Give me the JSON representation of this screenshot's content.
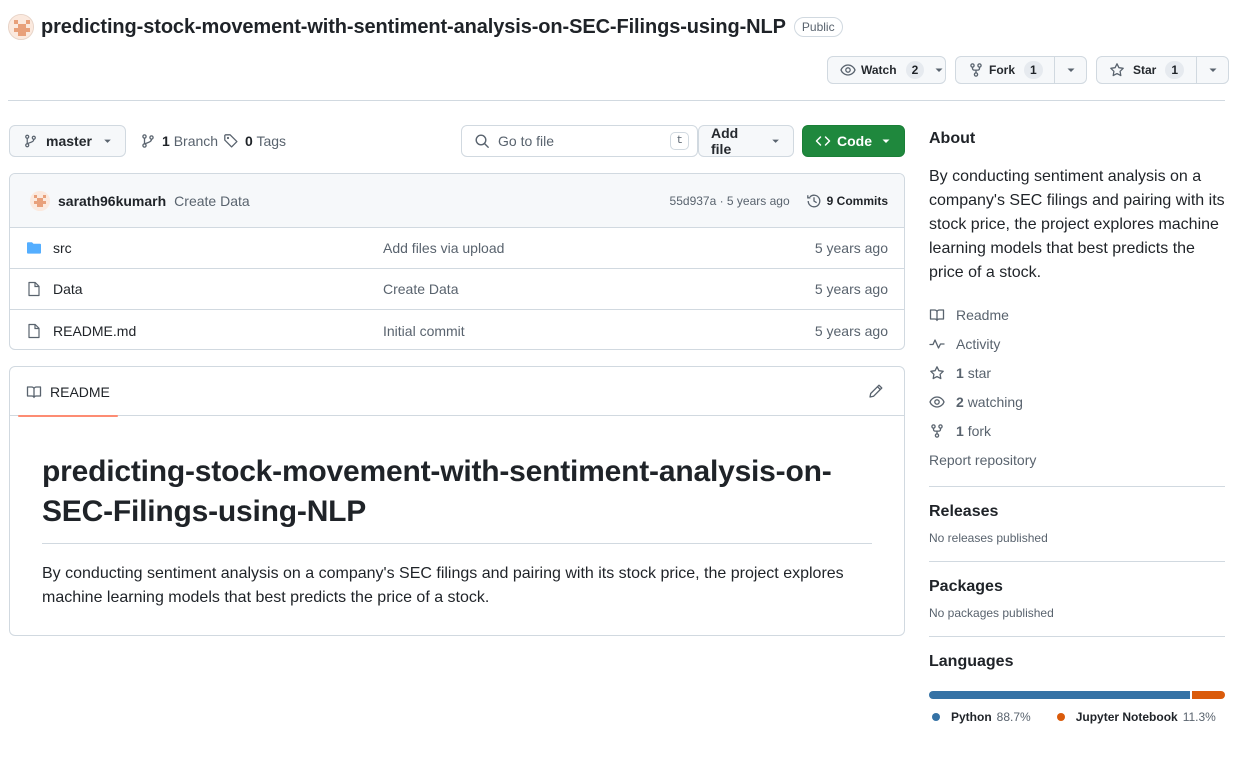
{
  "repo": {
    "name": "predicting-stock-movement-with-sentiment-analysis-on-SEC-Filings-using-NLP",
    "visibility": "Public"
  },
  "actions": {
    "watch_label": "Watch",
    "watch_count": "2",
    "fork_label": "Fork",
    "fork_count": "1",
    "star_label": "Star",
    "star_count": "1"
  },
  "toolbar": {
    "branch": "master",
    "branches_count": "1",
    "branches_label": "Branch",
    "tags_count": "0",
    "tags_label": "Tags",
    "goto_placeholder": "Go to file",
    "goto_shortcut": "t",
    "add_file_label": "Add file",
    "code_label": "Code"
  },
  "latest_commit": {
    "author": "sarath96kumarh",
    "message": "Create Data",
    "sha_time": "55d937a · 5 years ago",
    "commits_label": "9 Commits"
  },
  "files": [
    {
      "name": "src",
      "type": "folder",
      "message": "Add files via upload",
      "date": "5 years ago"
    },
    {
      "name": "Data",
      "type": "file",
      "message": "Create Data",
      "date": "5 years ago"
    },
    {
      "name": "README.md",
      "type": "file",
      "message": "Initial commit",
      "date": "5 years ago"
    }
  ],
  "readme": {
    "tab_label": "README",
    "heading_line1": "predicting-stock-movement-with-sentiment-analysis-on-",
    "heading_line2": "SEC-Filings-using-NLP",
    "body_line1": "By conducting sentiment analysis on a company's SEC filings and pairing with its stock price, the project explores",
    "body_line2": "machine learning models that best predicts the price of a stock."
  },
  "about": {
    "heading": "About",
    "description": "By conducting sentiment analysis on a company's SEC filings and pairing with its stock price, the project explores machine learning models that best predicts the price of a stock.",
    "readme": "Readme",
    "activity": "Activity",
    "stars_count": "1",
    "stars_label": "star",
    "watching_count": "2",
    "watching_label": "watching",
    "forks_count": "1",
    "forks_label": "fork",
    "report": "Report repository"
  },
  "releases": {
    "heading": "Releases",
    "note": "No releases published"
  },
  "packages": {
    "heading": "Packages",
    "note": "No packages published"
  },
  "languages": {
    "heading": "Languages",
    "items": [
      {
        "name": "Python",
        "percent": "88.7%",
        "value": 88.7,
        "color": "#3572A5"
      },
      {
        "name": "Jupyter Notebook",
        "percent": "11.3%",
        "value": 11.3,
        "color": "#DA5B0B"
      }
    ]
  },
  "colors": {
    "accent_green": "#1f883d",
    "underline": "#fd8c73",
    "folder_blue": "#54aeff"
  }
}
